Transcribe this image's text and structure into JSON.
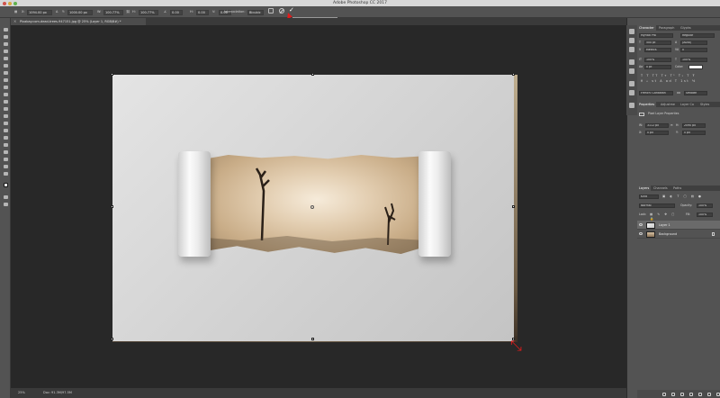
{
  "window": {
    "title": "Adobe Photoshop CC 2017"
  },
  "options_bar": {
    "x_value": "1094.00 px",
    "y_value": "1000.00 px",
    "w_value": "100.77%",
    "h_value": "100.77%",
    "angle_value": "0.00",
    "h_skew_value": "0.00",
    "v_skew_value": "0.00",
    "interpolation_label": "Interpolation:",
    "interpolation_value": "Bicubic",
    "commit_tooltip": "Commit Transform (Enter)"
  },
  "document": {
    "tab_title": "Pixabay.com-dead-trees-947151.jpg @ 25% (Layer 1, RGB/8#) *"
  },
  "status_bar": {
    "zoom": "25%",
    "doc_info": "Doc: 91.3M/97.5M"
  },
  "character_panel": {
    "tabs": [
      "Character",
      "Paragraph",
      "Glyphs"
    ],
    "font_family": "Myriad Pro",
    "font_style": "Regular",
    "font_size": "500 pt",
    "leading": "(Auto)",
    "kerning": "Metrics",
    "tracking": "0",
    "vertical_scale": "100%",
    "horizontal_scale": "100%",
    "baseline_shift": "0 pt",
    "color_label": "Color:",
    "language": "French: Canadian",
    "anti_alias": "Smooth"
  },
  "properties_panel": {
    "tabs": [
      "Properties",
      "Adjustme",
      "Layer Co",
      "Styles"
    ],
    "heading": "Pixel Layer Properties",
    "w_value": "3112 px",
    "h_value": "2090 px",
    "x_value": "0 px",
    "y_value": "0 px"
  },
  "layers_panel": {
    "tabs": [
      "Layers",
      "Channels",
      "Paths"
    ],
    "kind_filter": "Kind",
    "blend_mode": "Normal",
    "opacity_label": "Opacity:",
    "opacity_value": "100%",
    "lock_label": "Lock:",
    "fill_label": "Fill:",
    "fill_value": "100%",
    "layers": [
      {
        "name": "Layer 1",
        "selected": true
      },
      {
        "name": "Background",
        "selected": false
      }
    ]
  }
}
